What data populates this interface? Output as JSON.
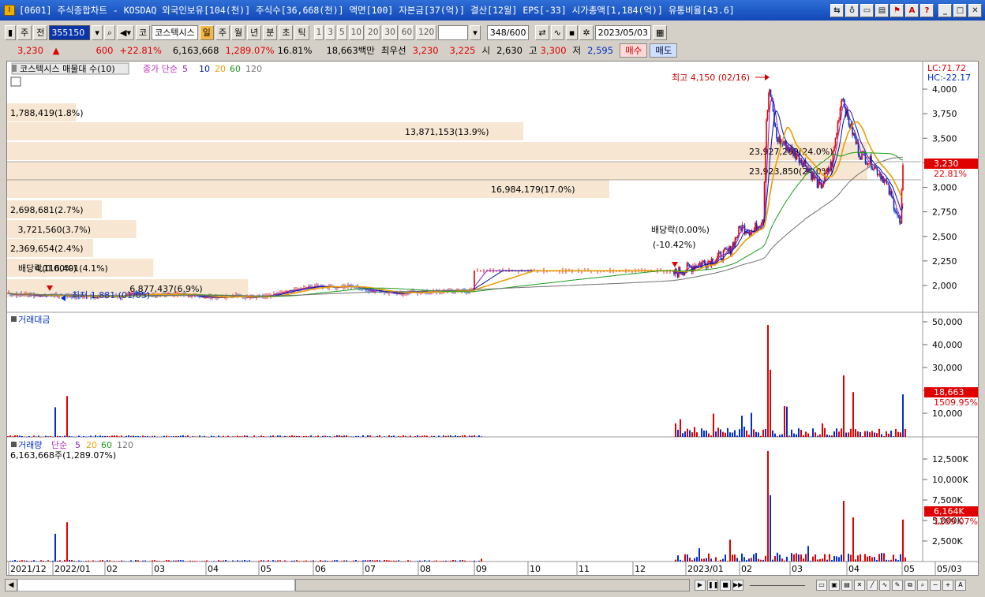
{
  "window": {
    "title": "[0601] 주식종합차트 - KOSDAQ 외국인보유[104(천)] 주식수[36,668(천)] 액면[100] 자본금[37(억)] 결산[12월] EPS[-33] 시가총액[1,184(억)] 유통비율[43.6]",
    "app_icon": "I"
  },
  "toolbar": {
    "market": "주",
    "prev": "전",
    "code": "355150",
    "stock_name": "코스텍시스",
    "period_buttons": [
      "일",
      "주",
      "월",
      "년",
      "분",
      "초",
      "틱"
    ],
    "selected_period": "일",
    "minute_values": [
      "1",
      "3",
      "5",
      "10",
      "20",
      "30",
      "60",
      "120"
    ],
    "count": "348",
    "total": "/600",
    "date": "2023/05/03",
    "kor_code": "코"
  },
  "quote": {
    "price": "3,230",
    "arrow": "▲",
    "change": "600",
    "change_pct": "+22.81%",
    "volume": "6,163,668",
    "volume_pct": "1,289.07%",
    "turnover": "16.81%",
    "amount": "18,663백만",
    "best_label": "최우선",
    "ask": "3,230",
    "bid": "3,225",
    "open_label": "시",
    "open": "2,630",
    "high_label": "고",
    "high": "3,300",
    "low_label": "저",
    "low": "2,595",
    "buy_label": "매수",
    "sell_label": "매도"
  },
  "price_panel": {
    "box_title": "코스텍시스 매물대 수(10)",
    "ma_label": "종가 단순",
    "ma_periods": [
      "5",
      "10",
      "20",
      "60",
      "120"
    ],
    "lc": "LC:71.72",
    "hc": "HC:-22.17",
    "y_ticks": [
      "4,000",
      "3,750",
      "3,500",
      "3,250",
      "3,000",
      "2,750",
      "2,500",
      "2,250",
      "2,000"
    ],
    "current_tag": "3,230",
    "current_pct": "22.81%",
    "high_note": "최고 4,150 (02/16)",
    "low_note": "최저 1,881 (01/05)",
    "dividend1": "배당락(0.00%)",
    "dividend2": "배당락(0.00%)",
    "dividend2_pct": "(-10.42%)",
    "volume_profile": [
      {
        "label": "1,788,419(1.8%)",
        "width": 0.08
      },
      {
        "label": "13,871,153(13.9%)",
        "width": 0.6
      },
      {
        "label": "23,927,209(24.0%)",
        "width": 1.0
      },
      {
        "label": "23,923,850(24.0%)",
        "width": 1.0
      },
      {
        "label": "16,984,179(17.0%)",
        "width": 0.7
      },
      {
        "label": "2,698,681(2.7%)",
        "width": 0.11
      },
      {
        "label": "3,721,560(3.7%)",
        "width": 0.15
      },
      {
        "label": "2,369,654(2.4%)",
        "width": 0.1
      },
      {
        "label": "4,116,401(4.1%)",
        "width": 0.17
      },
      {
        "label": "6,877,437(6.9%)",
        "width": 0.28
      }
    ]
  },
  "amount_panel": {
    "title": "거래대금",
    "y_ticks": [
      "50,000",
      "40,000",
      "30,000",
      "20,000",
      "10,000"
    ],
    "current_tag": "18,663",
    "current_pct": "1509.95%"
  },
  "volume_panel": {
    "title": "거래량",
    "ma_label": "단순",
    "ma_periods": [
      "5",
      "20",
      "60",
      "120"
    ],
    "summary": "6,163,668주(1,289.07%)",
    "y_ticks": [
      "12,500K",
      "10,000K",
      "7,500K",
      "5,000K",
      "2,500K"
    ],
    "current_tag": "6,164K",
    "current_pct": "1289.07%"
  },
  "x_axis": {
    "labels": [
      "2021/12",
      "2022/01",
      "02",
      "03",
      "04",
      "05",
      "06",
      "07",
      "08",
      "09",
      "10",
      "11",
      "12",
      "2023/01",
      "02",
      "03",
      "04",
      "05",
      "05/03"
    ]
  },
  "colors": {
    "up": "#e00000",
    "down": "#0030c8",
    "ma5": "#8b1ebd",
    "ma10": "#0018a0",
    "ma20": "#e8a000",
    "ma60": "#1a9a1a",
    "ma120": "#707070",
    "profile": "#f6e6d2"
  }
}
